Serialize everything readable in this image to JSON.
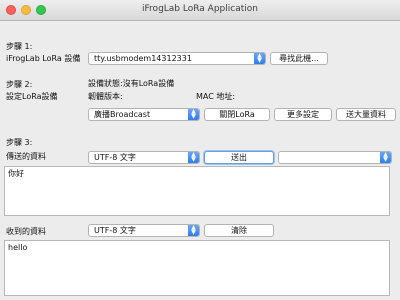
{
  "window": {
    "title": "iFrogLab LoRa Application"
  },
  "step1": {
    "heading": "步驟 1:",
    "device_label": "iFrogLab LoRa 設備",
    "port_value": "tty.usbmodem14312331",
    "find_button": "尋找此機..."
  },
  "step2": {
    "heading": "步驟 2:",
    "subheading": "設定LoRa設備",
    "status": "設備狀態:沒有LoRa設備",
    "firmware_label": "韌體版本:",
    "mac_label": "MAC 地址:",
    "mode_value": "廣播Broadcast",
    "close_button": "關閉LoRa",
    "more_button": "更多設定",
    "bulk_button": "送大量資料"
  },
  "step3": {
    "heading": "步驟 3:",
    "send_label": "傳送的資料",
    "send_encoding": "UTF-8 文字",
    "send_button": "送出",
    "extra_select": "",
    "send_text": "你好",
    "recv_label": "收到的資料",
    "recv_encoding": "UTF-8 文字",
    "clear_button": "清除",
    "recv_text": "hello"
  },
  "colors": {
    "accent": "#3b82f6",
    "close": "#fc605c",
    "minimize": "#fdbc40",
    "zoom": "#34c84a"
  },
  "icons": {
    "dropdown": "chevron-up-down-icon"
  }
}
